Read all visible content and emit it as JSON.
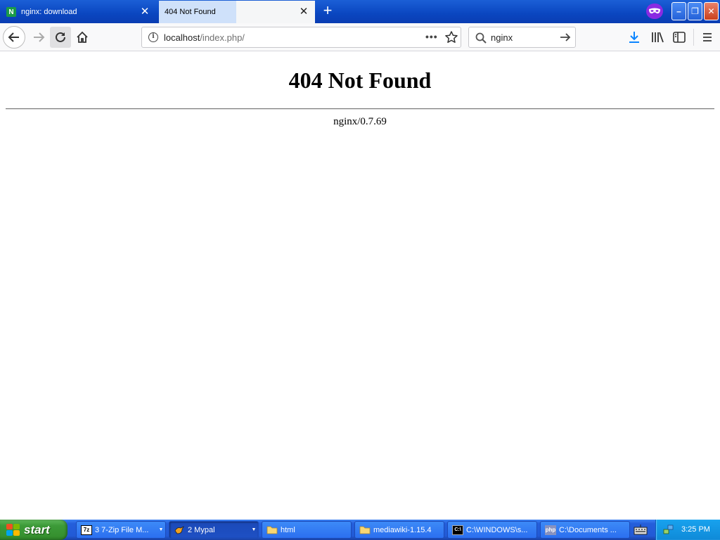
{
  "browser": {
    "tabs": [
      {
        "title": "nginx: download",
        "favicon": "N",
        "active": false
      },
      {
        "title": "404 Not Found",
        "active": true
      }
    ],
    "url": {
      "host": "localhost",
      "path": "/index.php/"
    },
    "search": {
      "value": "nginx"
    },
    "icons": [
      "back-arrow-icon",
      "forward-arrow-icon",
      "reload-icon",
      "home-icon",
      "info-icon",
      "page-actions-icon",
      "star-icon",
      "search-icon",
      "go-arrow-icon",
      "download-icon",
      "library-icon",
      "sidebar-icon",
      "menu-icon",
      "private-mask-icon"
    ],
    "window_buttons": {
      "minimize": "–",
      "maximize": "❐",
      "close": "✕"
    }
  },
  "page": {
    "heading": "404 Not Found",
    "server": "nginx/0.7.69"
  },
  "taskbar": {
    "start_label": "start",
    "items": [
      {
        "icon": "7z",
        "label": "3 7-Zip File M...",
        "group": true,
        "active": false
      },
      {
        "icon": "bird",
        "label": "2 Mypal",
        "group": true,
        "active": true
      },
      {
        "icon": "folder",
        "label": "html",
        "group": false,
        "active": false
      },
      {
        "icon": "folder",
        "label": "mediawiki-1.15.4",
        "group": false,
        "active": false
      },
      {
        "icon": "cmd",
        "label": "C:\\WINDOWS\\s...",
        "group": false,
        "active": false
      },
      {
        "icon": "php",
        "label": "C:\\Documents ...",
        "group": false,
        "active": false
      }
    ],
    "clock": "3:25 PM",
    "colors": {
      "taskbar": "#245edb",
      "start": "#3c9a38",
      "tray": "#0f8ad8"
    }
  }
}
